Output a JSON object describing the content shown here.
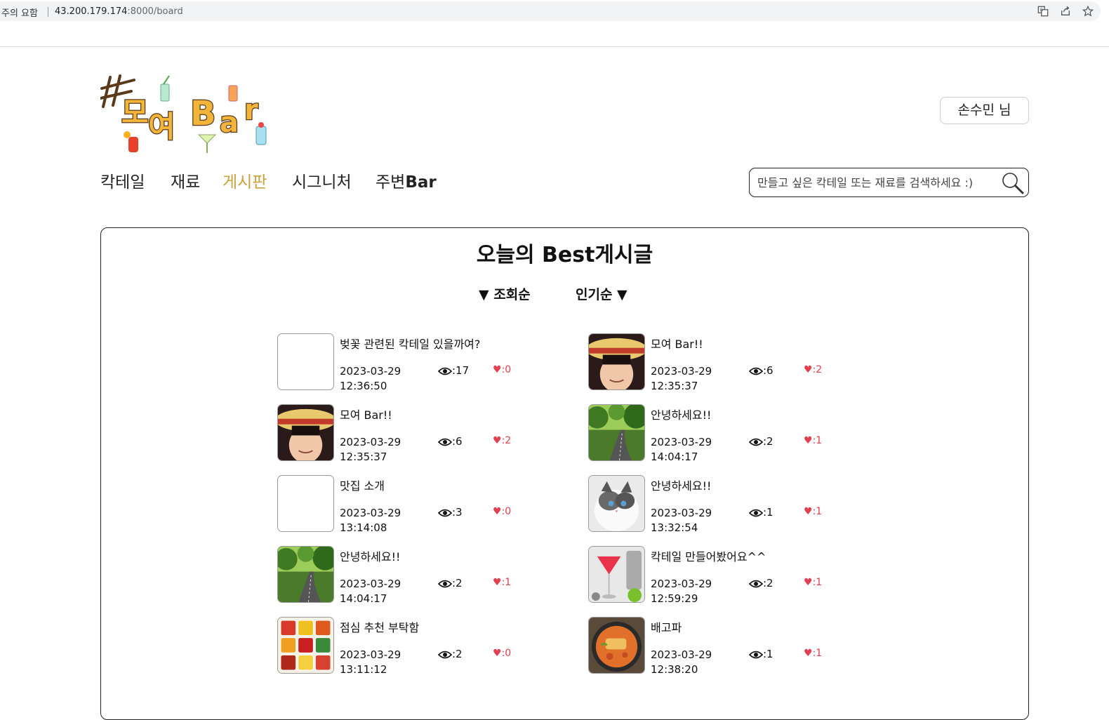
{
  "browser": {
    "security_label": "주의 요함",
    "url_host": "43.200.179.174",
    "url_path": ":8000/board",
    "icons": [
      "translate-icon",
      "share-icon",
      "star-icon"
    ]
  },
  "header": {
    "logo_text": "모여Bar",
    "user_label": "손수민 님",
    "nav": [
      {
        "label": "칵테일",
        "active": false
      },
      {
        "label": "재료",
        "active": false
      },
      {
        "label": "게시판",
        "active": true
      },
      {
        "label": "시그니처",
        "active": false
      },
      {
        "label_prefix": "주변",
        "label_bold": "Bar",
        "active": false
      }
    ],
    "search_placeholder": "만들고 싶은 칵테일 또는 재료를 검색하세요 :)",
    "accent_color": "#c9a23c"
  },
  "board": {
    "title": "오늘의 Best게시글",
    "sort_views": "▼ 조회순",
    "sort_likes": "인기순 ▼",
    "views_column": [
      {
        "title": "벚꽃 관련된 칵테일 있을까여?",
        "date": "2023-03-29",
        "time": "12:36:50",
        "views": ":17",
        "likes": ":0",
        "thumb": "blank"
      },
      {
        "title": "모여 Bar!!",
        "date": "2023-03-29",
        "time": "12:35:37",
        "views": ":6",
        "likes": ":2",
        "thumb": "hat-character"
      },
      {
        "title": "맛집 소개",
        "date": "2023-03-29",
        "time": "13:14:08",
        "views": ":3",
        "likes": ":0",
        "thumb": "blank"
      },
      {
        "title": "안녕하세요!!",
        "date": "2023-03-29",
        "time": "14:04:17",
        "views": ":2",
        "likes": ":1",
        "thumb": "forest-road"
      },
      {
        "title": "점심 추천 부탁함",
        "date": "2023-03-29",
        "time": "13:11:12",
        "views": ":2",
        "likes": ":0",
        "thumb": "noodle-cups"
      }
    ],
    "likes_column": [
      {
        "title": "모여 Bar!!",
        "date": "2023-03-29",
        "time": "12:35:37",
        "views": ":6",
        "likes": ":2",
        "thumb": "hat-character"
      },
      {
        "title": "안녕하세요!!",
        "date": "2023-03-29",
        "time": "14:04:17",
        "views": ":2",
        "likes": ":1",
        "thumb": "forest-road"
      },
      {
        "title": "안녕하세요!!",
        "date": "2023-03-29",
        "time": "13:32:54",
        "views": ":1",
        "likes": ":1",
        "thumb": "cat"
      },
      {
        "title": "칵테일 만들어봤어요^^",
        "date": "2023-03-29",
        "time": "12:59:29",
        "views": ":2",
        "likes": ":1",
        "thumb": "cocktail"
      },
      {
        "title": "배고파",
        "date": "2023-03-29",
        "time": "12:38:20",
        "views": ":1",
        "likes": ":1",
        "thumb": "stew"
      }
    ]
  }
}
